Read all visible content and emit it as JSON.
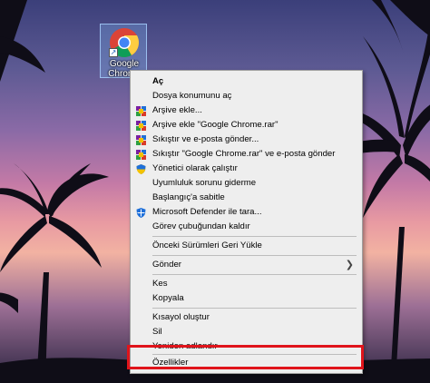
{
  "desktop": {
    "shortcut_label": "Google Chrome"
  },
  "menu": {
    "items": [
      {
        "label": "Aç",
        "icon": "none"
      },
      {
        "label": "Dosya konumunu aç",
        "icon": "none"
      },
      {
        "label": "Arşive ekle...",
        "icon": "winrar-icon"
      },
      {
        "label": "Arşive ekle \"Google Chrome.rar\"",
        "icon": "winrar-icon"
      },
      {
        "label": "Sıkıştır ve e-posta gönder...",
        "icon": "winrar-icon"
      },
      {
        "label": "Sıkıştır \"Google Chrome.rar\" ve e-posta gönder",
        "icon": "winrar-icon"
      },
      {
        "label": "Yönetici olarak çalıştır",
        "icon": "uac-shield-icon"
      },
      {
        "label": "Uyumluluk sorunu giderme",
        "icon": "none"
      },
      {
        "label": "Başlangıç'a sabitle",
        "icon": "none"
      },
      {
        "label": "Microsoft Defender ile tara...",
        "icon": "defender-icon"
      },
      {
        "label": "Görev çubuğundan kaldır",
        "icon": "none"
      },
      {
        "label": "Önceki Sürümleri Geri Yükle",
        "icon": "none"
      },
      {
        "label": "Gönder",
        "icon": "chevron-right-icon"
      },
      {
        "label": "Kes",
        "icon": "none"
      },
      {
        "label": "Kopyala",
        "icon": "none"
      },
      {
        "label": "Kısayol oluştur",
        "icon": "none"
      },
      {
        "label": "Sil",
        "icon": "none"
      },
      {
        "label": "Yeniden adlandır",
        "icon": "none"
      },
      {
        "label": "Özellikler",
        "icon": "none"
      }
    ],
    "highlight_color": "#e0141b"
  }
}
